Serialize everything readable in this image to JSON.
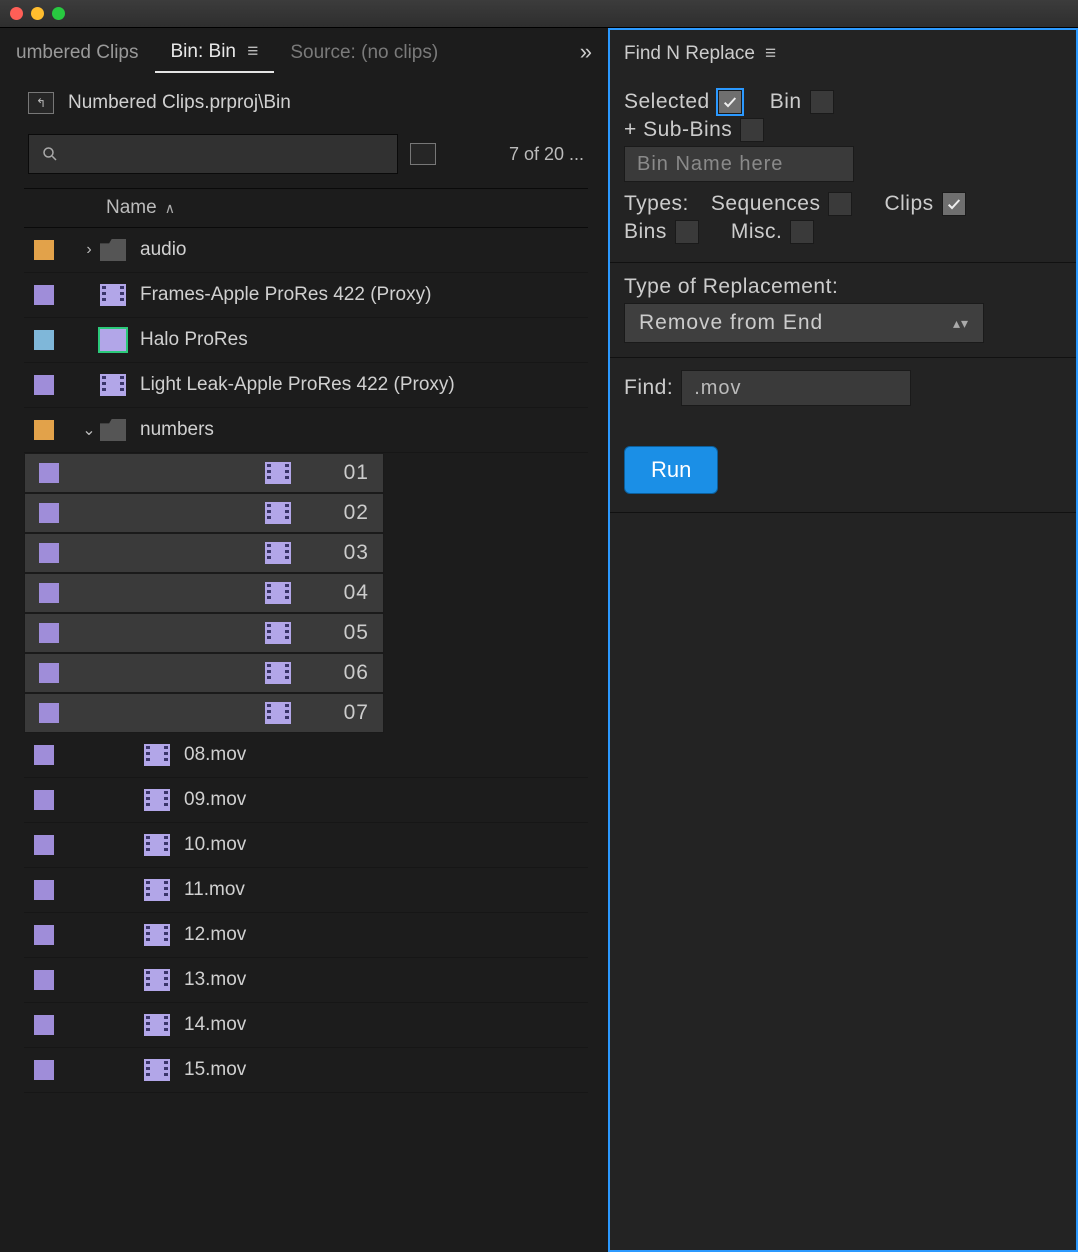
{
  "tabs": {
    "left": "umbered Clips",
    "mid": "Bin: Bin",
    "right": "Source: (no clips)"
  },
  "breadcrumb": "Numbered Clips.prproj\\Bin",
  "search_placeholder": "",
  "count_text": "7 of 20 ...",
  "col_name": "Name",
  "rows": [
    {
      "color": "c-orange",
      "depth": 1,
      "expand": "right",
      "icon": "folder",
      "label": "audio",
      "sel": false
    },
    {
      "color": "c-purple",
      "depth": 1,
      "expand": "",
      "icon": "clip",
      "label": "Frames-Apple ProRes 422 (Proxy)",
      "sel": false
    },
    {
      "color": "c-blue",
      "depth": 1,
      "expand": "",
      "icon": "seq",
      "label": "Halo ProRes",
      "sel": false
    },
    {
      "color": "c-purple",
      "depth": 1,
      "expand": "",
      "icon": "clip",
      "label": "Light Leak-Apple ProRes 422 (Proxy)",
      "sel": false
    },
    {
      "color": "c-orange",
      "depth": 1,
      "expand": "down",
      "icon": "folder",
      "label": "numbers",
      "sel": false
    },
    {
      "color": "c-purple",
      "depth": 2,
      "expand": "",
      "icon": "clip",
      "label": "01",
      "sel": true
    },
    {
      "color": "c-purple",
      "depth": 2,
      "expand": "",
      "icon": "clip",
      "label": "02",
      "sel": true
    },
    {
      "color": "c-purple",
      "depth": 2,
      "expand": "",
      "icon": "clip",
      "label": "03",
      "sel": true
    },
    {
      "color": "c-purple",
      "depth": 2,
      "expand": "",
      "icon": "clip",
      "label": "04",
      "sel": true
    },
    {
      "color": "c-purple",
      "depth": 2,
      "expand": "",
      "icon": "clip",
      "label": "05",
      "sel": true
    },
    {
      "color": "c-purple",
      "depth": 2,
      "expand": "",
      "icon": "clip",
      "label": "06",
      "sel": true
    },
    {
      "color": "c-purple",
      "depth": 2,
      "expand": "",
      "icon": "clip",
      "label": "07",
      "sel": true
    },
    {
      "color": "c-purple",
      "depth": 2,
      "expand": "",
      "icon": "clip",
      "label": "08.mov",
      "sel": false
    },
    {
      "color": "c-purple",
      "depth": 2,
      "expand": "",
      "icon": "clip",
      "label": "09.mov",
      "sel": false
    },
    {
      "color": "c-purple",
      "depth": 2,
      "expand": "",
      "icon": "clip",
      "label": "10.mov",
      "sel": false
    },
    {
      "color": "c-purple",
      "depth": 2,
      "expand": "",
      "icon": "clip",
      "label": "11.mov",
      "sel": false
    },
    {
      "color": "c-purple",
      "depth": 2,
      "expand": "",
      "icon": "clip",
      "label": "12.mov",
      "sel": false
    },
    {
      "color": "c-purple",
      "depth": 2,
      "expand": "",
      "icon": "clip",
      "label": "13.mov",
      "sel": false
    },
    {
      "color": "c-purple",
      "depth": 2,
      "expand": "",
      "icon": "clip",
      "label": "14.mov",
      "sel": false
    },
    {
      "color": "c-purple",
      "depth": 2,
      "expand": "",
      "icon": "clip",
      "label": "15.mov",
      "sel": false
    }
  ],
  "panel": {
    "title": "Find N Replace",
    "selected": "Selected",
    "bin": "Bin",
    "subbins": "+ Sub-Bins",
    "bin_placeholder": "Bin Name here",
    "types": "Types:",
    "sequences": "Sequences",
    "clips": "Clips",
    "bins": "Bins",
    "misc": "Misc.",
    "type_of": "Type of Replacement:",
    "replacement_mode": "Remove from End",
    "find": "Find:",
    "find_value": ".mov",
    "run": "Run"
  }
}
